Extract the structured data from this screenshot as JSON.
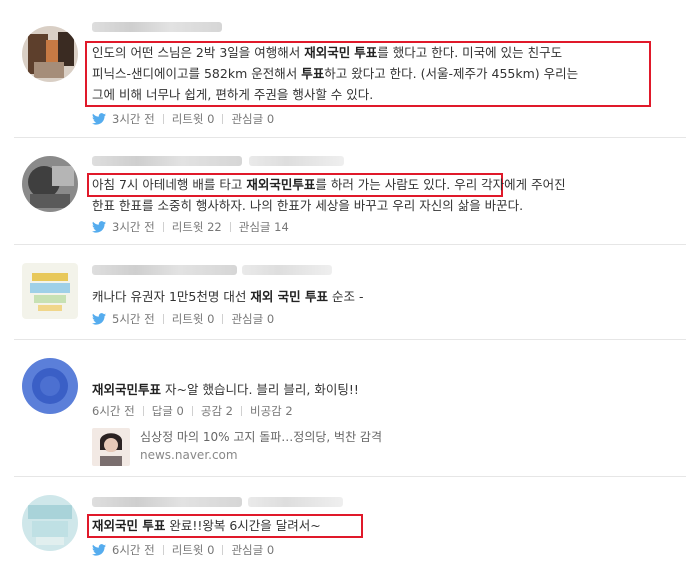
{
  "posts": [
    {
      "line1": {
        "pre": "인도의 어떤 스님은 2박 3일을 여행해서 ",
        "b1": "재외국민",
        "mid": " ",
        "b2": "투표",
        "post": "를 했다고 한다. 미국에 있는 친구도"
      },
      "line2": {
        "pre": "피닉스-샌디에이고를 582km 운전해서 ",
        "b1": "투표",
        "post": "하고 왔다고 한다. (서울-제주가 455km) 우리는"
      },
      "line3": "그에 비해 너무나 쉽게, 편하게 주권을 행사할 수 있다.",
      "meta": [
        "3시간 전",
        "리트윗 0",
        "관심글 0"
      ]
    },
    {
      "line1": {
        "pre": "아침 7시 아테네행 배를 타고 ",
        "b1": "재외국민",
        "b2": "투표",
        "post": "를 하러 가는 사람도 있다.",
        "tail": " 우리 각자에게 주어진"
      },
      "line2": "한표 한표를 소중히 행사하자. 나의 한표가 세상을 바꾸고 우리 자신의 삶을 바꾼다.",
      "meta": [
        "3시간 전",
        "리트윗 22",
        "관심글 14"
      ]
    },
    {
      "line1": {
        "pre": "캐나다 유권자 1만5천명 대선 ",
        "b1": "재외 국민 투표",
        "post": " 순조 -"
      },
      "meta": [
        "5시간 전",
        "리트윗 0",
        "관심글 0"
      ]
    },
    {
      "line1": {
        "b1": "재외국민",
        "b2": "투표",
        "post": " 자~알 했습니다. 블리 블리, 화이팅!!"
      },
      "meta": [
        "6시간 전",
        "답글 0",
        "공감 2",
        "비공감 2"
      ],
      "news": {
        "title": "심상정 마의 10% 고지 돌파…정의당, 벅찬 감격",
        "url": "news.naver.com"
      }
    },
    {
      "line1": {
        "b1": "재외국민 투표",
        "post": " 완료!!왕복 6시간을 달려서~"
      },
      "meta": [
        "6시간 전",
        "리트윗 0",
        "관심글 0"
      ]
    }
  ],
  "colors": {
    "highlight": "#e0192a",
    "twitter": "#55acee"
  },
  "icons": {
    "twitter": "twitter-bird-icon"
  }
}
